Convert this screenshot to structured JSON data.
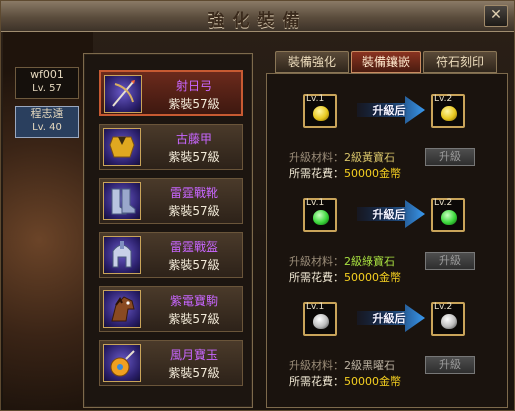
{
  "window": {
    "title": "強化裝備",
    "close_symbol": "✕"
  },
  "characters": [
    {
      "name": "wf001",
      "level": "Lv. 57",
      "active": false
    },
    {
      "name": "程志遠",
      "level": "Lv. 40",
      "active": true
    }
  ],
  "items": [
    {
      "name": "射日弓",
      "grade": "紫裝57級",
      "icon": "bow-icon",
      "selected": true
    },
    {
      "name": "古藤甲",
      "grade": "紫裝57級",
      "icon": "armor-icon",
      "selected": false
    },
    {
      "name": "雷霆戰靴",
      "grade": "紫裝57級",
      "icon": "boots-icon",
      "selected": false
    },
    {
      "name": "雷霆戰盔",
      "grade": "紫裝57級",
      "icon": "helmet-icon",
      "selected": false
    },
    {
      "name": "紫電寶駒",
      "grade": "紫裝57級",
      "icon": "horse-icon",
      "selected": false
    },
    {
      "name": "風月寶玉",
      "grade": "紫裝57級",
      "icon": "jade-icon",
      "selected": false
    }
  ],
  "tabs": [
    {
      "label": "裝備強化",
      "active": false
    },
    {
      "label": "裝備鑲嵌",
      "active": true
    },
    {
      "label": "符石刻印",
      "active": false
    }
  ],
  "gems": [
    {
      "from_level": "Lv.1",
      "to_level": "Lv.2",
      "arrow_label": "升級后",
      "material_label": "升級材料：",
      "material_value": "2級黃寶石",
      "cost_label": "所需花費：",
      "cost_value": "50000金幣",
      "button_label": "升級",
      "color": "#e8c820",
      "value_color": "yellow"
    },
    {
      "from_level": "Lv.1",
      "to_level": "Lv.2",
      "arrow_label": "升級后",
      "material_label": "升級材料：",
      "material_value": "2級綠寶石",
      "cost_label": "所需花費：",
      "cost_value": "50000金幣",
      "button_label": "升級",
      "color": "#3cd83c",
      "value_color": "green"
    },
    {
      "from_level": "Lv.1",
      "to_level": "Lv.2",
      "arrow_label": "升級后",
      "material_label": "升級材料：",
      "material_value": "2級黑曜石",
      "cost_label": "所需花費：",
      "cost_value": "50000金幣",
      "button_label": "升級",
      "color": "#d8d8d8",
      "value_color": "gray"
    }
  ]
}
